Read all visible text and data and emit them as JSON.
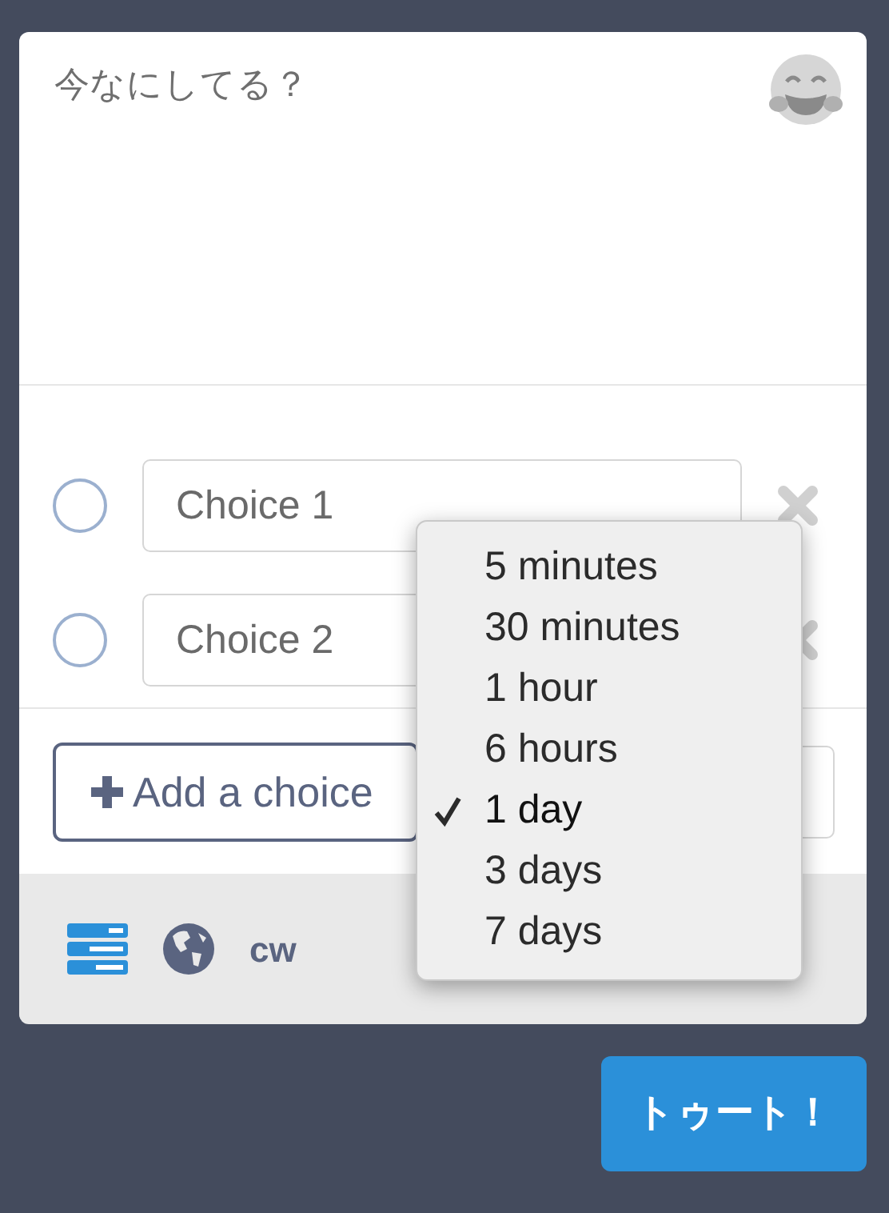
{
  "compose": {
    "placeholder": "今なにしてる？"
  },
  "poll": {
    "options": [
      {
        "placeholder": "Choice 1",
        "selected": false
      },
      {
        "placeholder": "Choice 2",
        "selected": false
      }
    ],
    "add_button": "Add a choice",
    "duration_menu": [
      {
        "label": "5 minutes",
        "selected": false
      },
      {
        "label": "30 minutes",
        "selected": false
      },
      {
        "label": "1 hour",
        "selected": false
      },
      {
        "label": "6 hours",
        "selected": false
      },
      {
        "label": "1 day",
        "selected": true
      },
      {
        "label": "3 days",
        "selected": false
      },
      {
        "label": "7 days",
        "selected": false
      }
    ]
  },
  "footer": {
    "cw": "cw"
  },
  "submit": "トゥート！"
}
